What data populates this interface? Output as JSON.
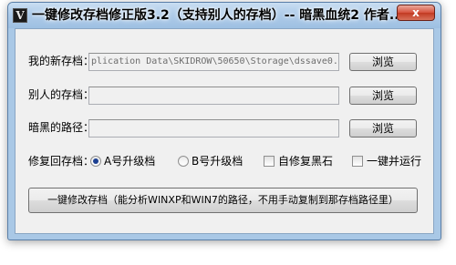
{
  "window": {
    "title": "一键修改存档修正版3.2（支持别人的存档）-- 暗黑血统2  作者...",
    "app_icon_glyph": "Ⅴ",
    "close_glyph": "x"
  },
  "rows": [
    {
      "label": "我的新存档：",
      "value": "plication Data\\SKIDROW\\50650\\Storage\\dssave0.dsav",
      "button": "浏览"
    },
    {
      "label": "别人的存档：",
      "value": "",
      "button": "浏览"
    },
    {
      "label": "暗黑的路径：",
      "value": "",
      "button": "浏览"
    }
  ],
  "options": {
    "label": "修复回存档：",
    "radio_a": {
      "label": "A号升级档",
      "selected": true
    },
    "radio_b": {
      "label": "B号升级档",
      "selected": false
    },
    "check_auto_fix": {
      "label": "自修复黑石",
      "checked": false
    },
    "check_run": {
      "label": "一键并运行",
      "checked": false
    }
  },
  "main_button": "一键修改存档（能分析WINXP和WIN7的路径，不用手动复制到那存档路径里）",
  "colors": {
    "frame": "#a9c8e6",
    "client": "#f0f0f0",
    "close": "#c13a22",
    "radio_dot": "#1c3f91"
  }
}
